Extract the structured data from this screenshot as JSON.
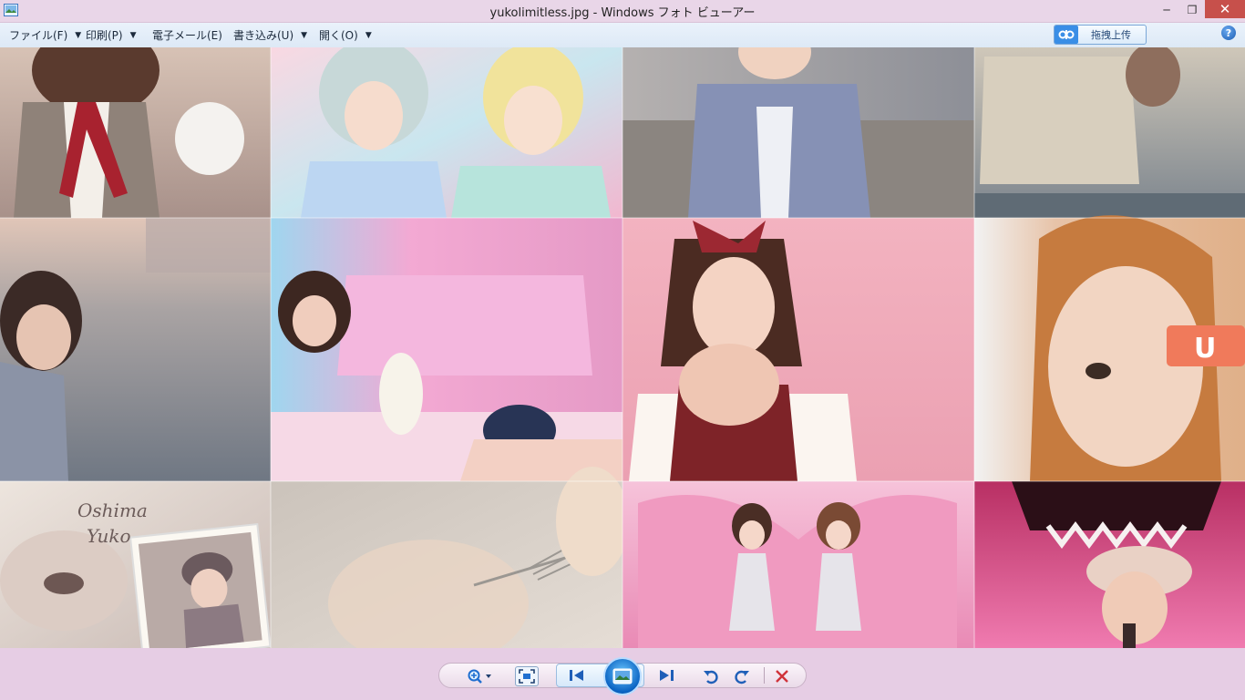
{
  "window": {
    "title": "yukolimitless.jpg - Windows フォト ビューアー",
    "minimize_glyph": "─",
    "maximize_glyph": "❐",
    "close_glyph": "✕"
  },
  "menu": {
    "items": [
      {
        "label": "ファイル(F)",
        "has_dropdown": true
      },
      {
        "label": "印刷(P)",
        "has_dropdown": true
      },
      {
        "label": "電子メール(E)",
        "has_dropdown": false
      },
      {
        "label": "書き込み(U)",
        "has_dropdown": true
      },
      {
        "label": "開く(O)",
        "has_dropdown": true
      }
    ],
    "upload_label": "拖拽上传",
    "help_glyph": "?"
  },
  "photo": {
    "filename": "yukolimitless.jpg",
    "tiles": [
      {
        "colors": [
          "#c9b2a6",
          "#7a6458"
        ],
        "subject": "girl-gray-jacket-red-ribbon"
      },
      {
        "colors": [
          "#f7c7d6",
          "#b9e0e8"
        ],
        "subject": "two-girls-pastel"
      },
      {
        "colors": [
          "#b8b6b8",
          "#7d86a8"
        ],
        "subject": "girl-blue-coat-waterfront"
      },
      {
        "colors": [
          "#c9c1b2",
          "#6e7a86"
        ],
        "subject": "window-reflection"
      },
      {
        "colors": [
          "#c5a99a",
          "#6f7a90"
        ],
        "subject": "girl-river-sunset"
      },
      {
        "colors": [
          "#f2a9cf",
          "#d57bb4"
        ],
        "subject": "girls-pink-room-plush"
      },
      {
        "colors": [
          "#f1a7b8",
          "#8c3b3b"
        ],
        "subject": "girl-hands-face-pink"
      },
      {
        "colors": [
          "#eed4c4",
          "#c8895a"
        ],
        "subject": "girl-orange-hair-closeup"
      },
      {
        "colors": [
          "#e5ddd6",
          "#a98e8a"
        ],
        "subject": "oshima-yuko-collage"
      },
      {
        "colors": [
          "#d9d0c8",
          "#b6aa9e"
        ],
        "subject": "fork-blurred"
      },
      {
        "colors": [
          "#f2a6c6",
          "#dc7aa6"
        ],
        "subject": "two-girls-pink-heart"
      },
      {
        "colors": [
          "#d94f86",
          "#5a1f2e"
        ],
        "subject": "girl-hat-stage"
      }
    ],
    "collage_text": [
      "Oshima",
      "Yuko"
    ]
  },
  "toolbar": {
    "zoom_icon": "magnifier-icon",
    "fit_icon": "actual-size-icon",
    "prev_icon": "previous-icon",
    "slideshow_icon": "slideshow-icon",
    "next_icon": "next-icon",
    "rotate_ccw_icon": "rotate-left-icon",
    "rotate_cw_icon": "rotate-right-icon",
    "delete_icon": "delete-icon"
  },
  "colors": {
    "titlebar": "#e9d6e8",
    "close_button": "#c7504b",
    "toolbar_bg": "#e6cde4",
    "accent_blue": "#1f6fd0",
    "delete_red": "#d0333a"
  }
}
